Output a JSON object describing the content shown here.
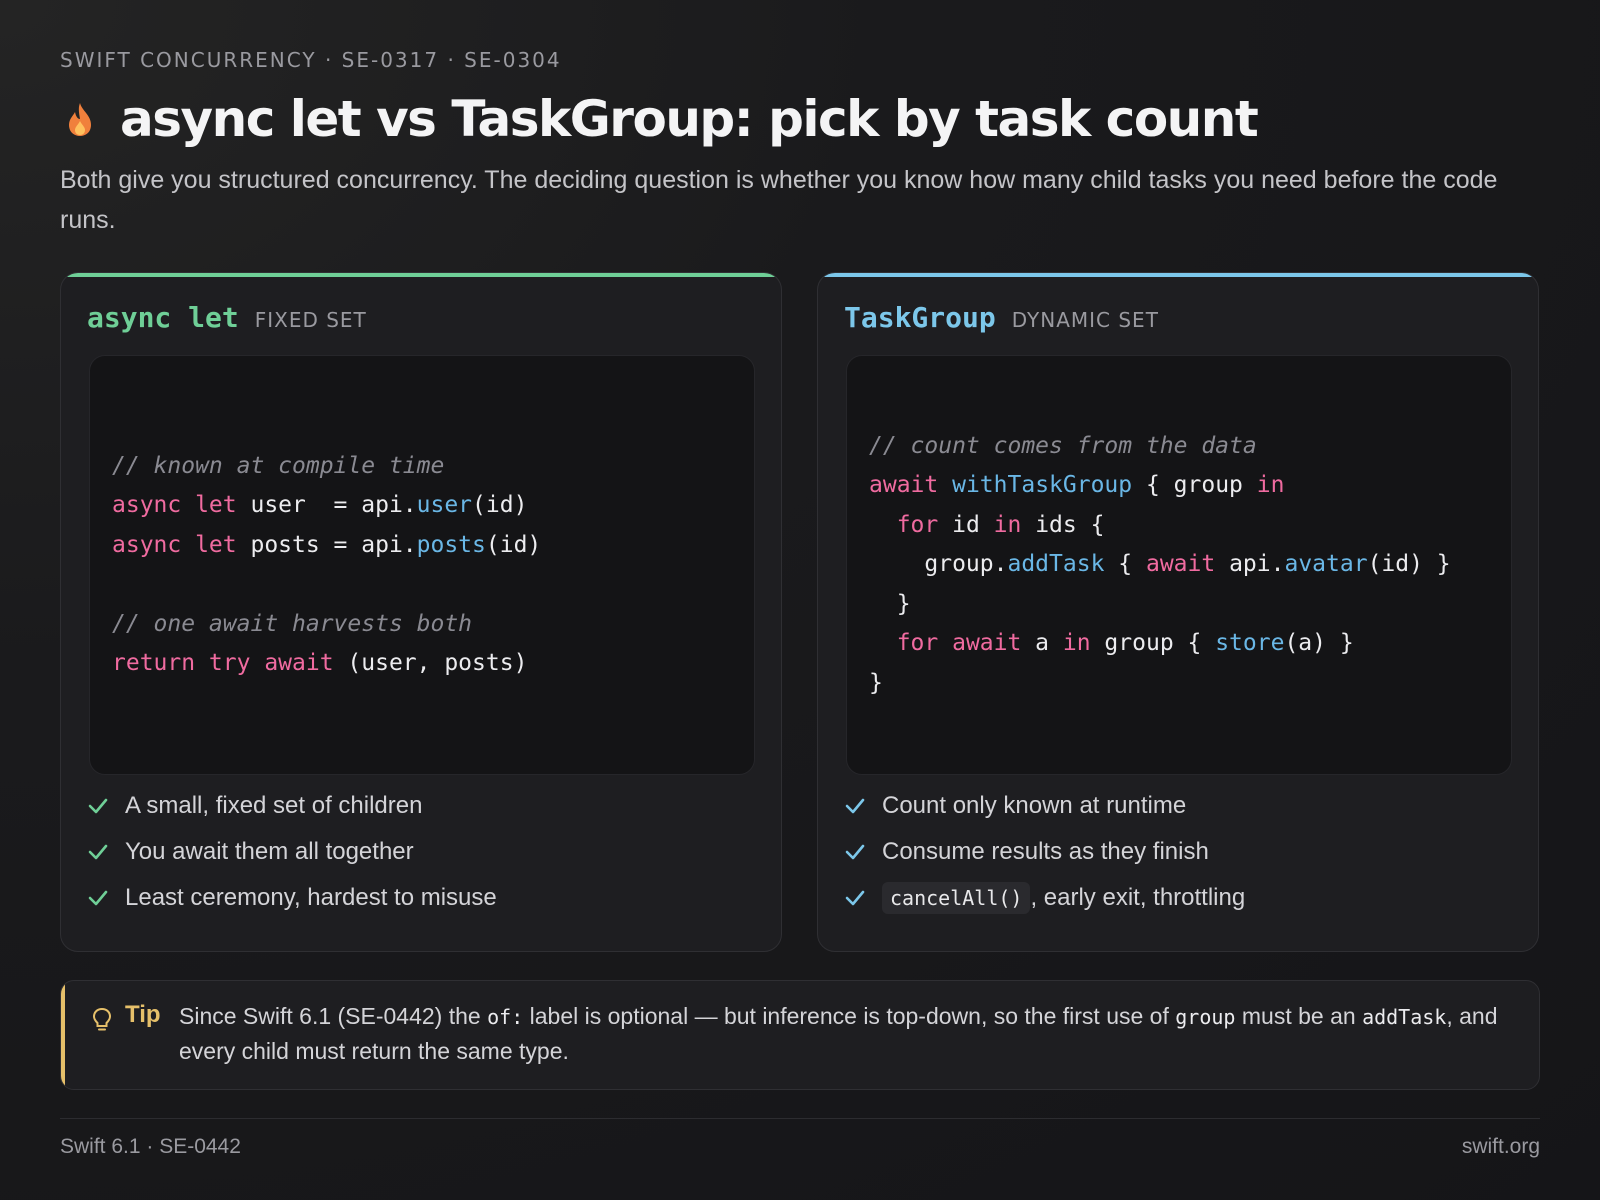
{
  "header": {
    "eyebrow": "SWIFT CONCURRENCY · SE-0317 · SE-0304",
    "title": "async let vs TaskGroup: pick by task count",
    "subtitle": "Both give you structured concurrency. The deciding question is whether you know how many child tasks you need before the code runs.",
    "icon": "flame-icon"
  },
  "colors": {
    "left_accent": "#6fcf97",
    "right_accent": "#7cc7ea",
    "keyword": "#f06ba0",
    "function": "#6ab7e6",
    "tip_accent": "#e6c06a"
  },
  "cards": {
    "left": {
      "keyword": "async let",
      "tag": "FIXED SET",
      "code": [
        [
          {
            "t": "// known at compile time",
            "c": "com"
          }
        ],
        [
          {
            "t": "async let",
            "c": "kw"
          },
          {
            "t": " user  = api."
          },
          {
            "t": "user",
            "c": "fn"
          },
          {
            "t": "(id)"
          }
        ],
        [
          {
            "t": "async let",
            "c": "kw"
          },
          {
            "t": " posts = api."
          },
          {
            "t": "posts",
            "c": "fn"
          },
          {
            "t": "(id)"
          }
        ],
        [],
        [
          {
            "t": "// one await harvests both",
            "c": "com"
          }
        ],
        [
          {
            "t": "return try await",
            "c": "kw"
          },
          {
            "t": " (user, posts)"
          }
        ]
      ],
      "bullets": [
        "A small, fixed set of children",
        "You await them all together",
        "Least ceremony, hardest to misuse"
      ]
    },
    "right": {
      "keyword": "TaskGroup",
      "tag": "DYNAMIC SET",
      "code": [
        [
          {
            "t": "// count comes from the data",
            "c": "com"
          }
        ],
        [
          {
            "t": "await",
            "c": "kw"
          },
          {
            "t": " "
          },
          {
            "t": "withTaskGroup",
            "c": "fn"
          },
          {
            "t": " { group "
          },
          {
            "t": "in",
            "c": "kw"
          }
        ],
        [
          {
            "t": "  "
          },
          {
            "t": "for",
            "c": "kw"
          },
          {
            "t": " id "
          },
          {
            "t": "in",
            "c": "kw"
          },
          {
            "t": " ids {"
          }
        ],
        [
          {
            "t": "    group."
          },
          {
            "t": "addTask",
            "c": "fn"
          },
          {
            "t": " { "
          },
          {
            "t": "await",
            "c": "kw"
          },
          {
            "t": " api."
          },
          {
            "t": "avatar",
            "c": "fn"
          },
          {
            "t": "(id) }"
          }
        ],
        [
          {
            "t": "  }"
          }
        ],
        [
          {
            "t": "  "
          },
          {
            "t": "for await",
            "c": "kw"
          },
          {
            "t": " a "
          },
          {
            "t": "in",
            "c": "kw"
          },
          {
            "t": " group { "
          },
          {
            "t": "store",
            "c": "fn"
          },
          {
            "t": "(a) }"
          }
        ],
        [
          {
            "t": "}"
          }
        ]
      ],
      "bullets": [
        "Count only known at runtime",
        "Consume results as they finish"
      ],
      "bullet3_code": "cancelAll()",
      "bullet3_text": ", early exit, throttling"
    }
  },
  "tip": {
    "label": "Tip",
    "part1": "Since Swift 6.1 (SE-0442) the ",
    "code1": "of:",
    "part2": " label is optional — but inference is top-down, so the first use of ",
    "code2": "group",
    "part3": " must be an ",
    "code3": "addTask",
    "part4": ", and every child must return the same type.",
    "icon": "lightbulb-icon"
  },
  "footer": {
    "left": "Swift 6.1 · SE-0442",
    "right": "swift.org"
  }
}
